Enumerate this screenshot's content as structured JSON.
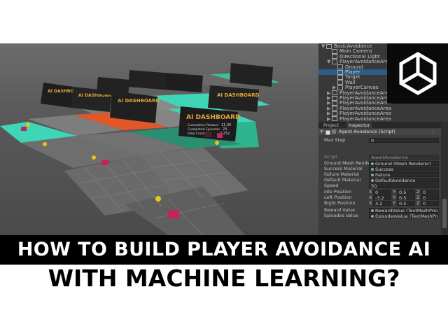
{
  "hierarchy": {
    "items": [
      {
        "label": "BasicAvoidance",
        "depth": 0,
        "arrow": "▼",
        "selected": false
      },
      {
        "label": "Main Camera",
        "depth": 1,
        "arrow": "",
        "selected": false
      },
      {
        "label": "Directional Light",
        "depth": 1,
        "arrow": "",
        "selected": false
      },
      {
        "label": "PlayerAvoidanceArea",
        "depth": 1,
        "arrow": "▼",
        "selected": false
      },
      {
        "label": "Ground",
        "depth": 2,
        "arrow": "",
        "selected": false
      },
      {
        "label": "Player",
        "depth": 2,
        "arrow": "",
        "selected": true
      },
      {
        "label": "Target",
        "depth": 2,
        "arrow": "",
        "selected": false
      },
      {
        "label": "Wall",
        "depth": 2,
        "arrow": "",
        "selected": false
      },
      {
        "label": "PlayerCanvas",
        "depth": 2,
        "arrow": "▶",
        "selected": false
      },
      {
        "label": "PlayerAvoidanceArea",
        "depth": 1,
        "arrow": "▶",
        "selected": false
      },
      {
        "label": "PlayerAvoidanceArea",
        "depth": 1,
        "arrow": "▶",
        "selected": false
      },
      {
        "label": "PlayerAvoidanceArea",
        "depth": 1,
        "arrow": "▶",
        "selected": false
      },
      {
        "label": "PlayerAvoidanceArea",
        "depth": 1,
        "arrow": "▶",
        "selected": false
      },
      {
        "label": "PlayerAvoidanceArea",
        "depth": 1,
        "arrow": "▶",
        "selected": false
      },
      {
        "label": "PlayerAvoidanceArea",
        "depth": 1,
        "arrow": "▶",
        "selected": false
      }
    ]
  },
  "inspector": {
    "tabs": [
      "Project",
      "Inspector"
    ],
    "component_title": "Agent Avoidance (Script)",
    "max_step": {
      "label": "Max Step",
      "value": "0"
    },
    "script": {
      "label": "Script",
      "value": "AgentAvoidance"
    },
    "rows": [
      {
        "label": "Ground Mesh Rendere",
        "value": "Ground (Mesh Renderer)"
      },
      {
        "label": "Success Material",
        "value": "Success"
      },
      {
        "label": "Failure Material",
        "value": "Failure"
      },
      {
        "label": "Default Material",
        "value": "DefaultAvoidance"
      },
      {
        "label": "Speed",
        "value": "50"
      }
    ],
    "positions": [
      {
        "label": "Idle Position",
        "x": "0",
        "y": "0.5",
        "z": "0"
      },
      {
        "label": "Left Position",
        "x": "-3.2",
        "y": "0.5",
        "z": "0"
      },
      {
        "label": "Right Position",
        "x": "3.2",
        "y": "0.5",
        "z": "0"
      }
    ],
    "value_rows": [
      {
        "label": "Reward Value",
        "value": "RewardValue (TextMeshProUG"
      },
      {
        "label": "Episodes Value",
        "value": "EpisodesValue (TextMeshProU"
      }
    ]
  },
  "scene": {
    "dashboard_title": "AI DASHBOARD",
    "dash_labels": [
      "Cumulative Reward",
      "Completed Episodes",
      "Step Count"
    ],
    "dash_values": [
      "11.00",
      "23",
      "2,252"
    ],
    "colors": {
      "success": "#3fd6b8",
      "failure": "#e0582a",
      "floor": "#6e6e6e",
      "target": "#e6c619",
      "player": "#c4245e"
    }
  },
  "title": {
    "line1": "HOW TO BUILD PLAYER AVOIDANCE AI",
    "line2": "WITH MACHINE LEARNING?"
  }
}
